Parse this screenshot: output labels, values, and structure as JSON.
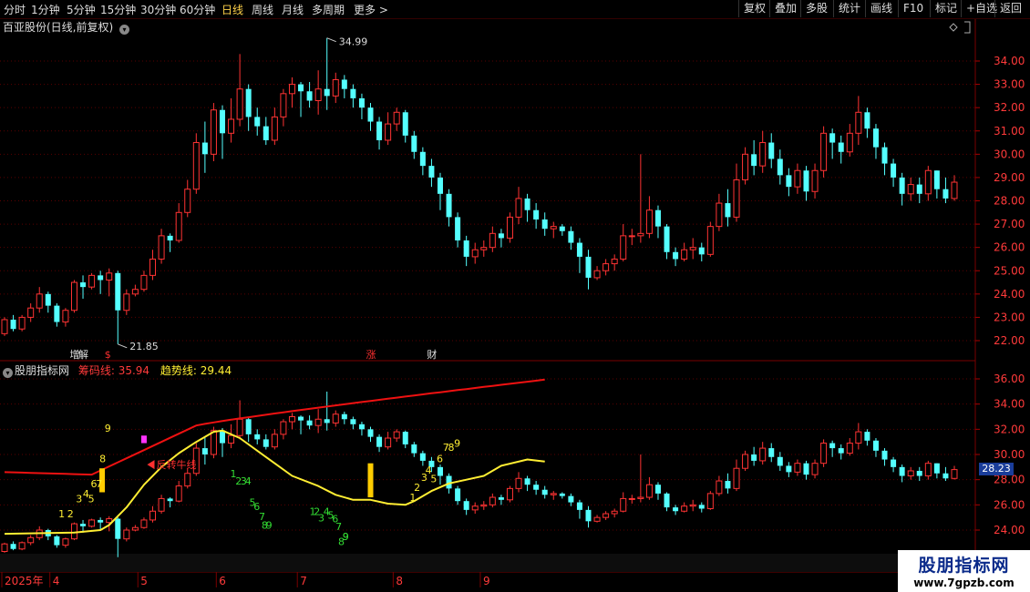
{
  "toolbar": {
    "periods": [
      "分时",
      "1分钟",
      "5分钟",
      "15分钟",
      "30分钟",
      "60分钟",
      "日线",
      "周线",
      "月线",
      "多周期",
      "更多 >"
    ],
    "active": "日线",
    "right": [
      "复权",
      "叠加",
      "多股",
      "统计",
      "画线",
      "F10",
      "标记",
      "+自选",
      "返回"
    ]
  },
  "main": {
    "title": "百亚股份(日线,前复权)",
    "high_label": "34.99",
    "low_label": "21.85",
    "events": [
      {
        "text": "增",
        "color": "#e0e0e0",
        "i": 8
      },
      {
        "text": "解",
        "color": "#e0e0e0",
        "i": 9
      },
      {
        "text": "$",
        "color": "#ff3030",
        "i": 12
      },
      {
        "text": "涨",
        "color": "#ff3030",
        "i": 42
      },
      {
        "text": "财",
        "color": "#e0e0e0",
        "i": 49
      }
    ]
  },
  "indicator": {
    "name": "股朋指标网",
    "line1_label": "筹码线: 35.94",
    "line2_label": "趋势线: 29.44",
    "annotation": "反转牛线",
    "current_price": "28.23"
  },
  "colors": {
    "up": "#ff3333",
    "down": "#54ffff",
    "ma_red": "#ee1111",
    "ma_yellow": "#ffee33",
    "grid": "#5a0000"
  },
  "logo": {
    "line1": "股朋指标网",
    "line2": "www.7gpzb.com"
  },
  "chart_data": {
    "type": "candlestick",
    "y_axis_main": [
      22.0,
      23.0,
      24.0,
      25.0,
      26.0,
      27.0,
      28.0,
      29.0,
      30.0,
      31.0,
      32.0,
      33.0,
      34.0
    ],
    "y_axis_indicator": [
      24.0,
      26.0,
      28.0,
      30.0,
      32.0,
      34.0,
      36.0
    ],
    "x_axis": [
      "2025年",
      "4",
      "5",
      "6",
      "7",
      "8",
      "9"
    ],
    "x_axis_idx": [
      0,
      5.2,
      15.3,
      24.3,
      33.6,
      44.6,
      54.6
    ],
    "candles": [
      [
        22.3,
        22.9,
        22.2,
        23.0
      ],
      [
        22.9,
        22.5,
        22.4,
        23.1
      ],
      [
        22.5,
        23.0,
        22.4,
        23.1
      ],
      [
        23.0,
        23.4,
        22.8,
        23.6
      ],
      [
        23.4,
        24.0,
        23.2,
        24.3
      ],
      [
        24.0,
        23.5,
        23.2,
        24.1
      ],
      [
        23.5,
        22.8,
        22.6,
        23.6
      ],
      [
        22.8,
        23.3,
        22.6,
        23.4
      ],
      [
        23.3,
        24.5,
        23.2,
        24.6
      ],
      [
        24.5,
        24.3,
        23.8,
        24.8
      ],
      [
        24.3,
        24.8,
        24.2,
        24.9
      ],
      [
        24.8,
        24.6,
        24.0,
        25.0
      ],
      [
        24.6,
        24.9,
        23.9,
        25.1
      ],
      [
        24.9,
        23.3,
        21.85,
        25.0
      ],
      [
        23.3,
        24.0,
        23.1,
        24.2
      ],
      [
        24.0,
        24.2,
        23.9,
        24.4
      ],
      [
        24.2,
        24.8,
        24.1,
        25.0
      ],
      [
        24.8,
        25.5,
        24.6,
        25.9
      ],
      [
        25.5,
        26.5,
        25.3,
        26.8
      ],
      [
        26.5,
        26.3,
        25.8,
        26.6
      ],
      [
        26.3,
        27.5,
        26.2,
        27.9
      ],
      [
        27.5,
        28.5,
        27.3,
        28.9
      ],
      [
        28.5,
        30.5,
        28.3,
        30.9
      ],
      [
        30.5,
        30.0,
        29.2,
        31.4
      ],
      [
        30.0,
        31.9,
        29.7,
        32.2
      ],
      [
        31.9,
        30.9,
        29.8,
        32.1
      ],
      [
        30.9,
        31.5,
        30.5,
        32.4
      ],
      [
        31.5,
        32.8,
        31.2,
        34.3
      ],
      [
        32.8,
        31.6,
        31.0,
        33.0
      ],
      [
        31.6,
        31.2,
        30.8,
        32.0
      ],
      [
        31.2,
        30.6,
        30.4,
        31.6
      ],
      [
        30.6,
        31.6,
        30.4,
        32.0
      ],
      [
        31.6,
        32.6,
        31.2,
        32.8
      ],
      [
        32.6,
        33.0,
        32.0,
        33.3
      ],
      [
        33.0,
        32.7,
        31.6,
        33.1
      ]
    ],
    "candles2": [
      [
        32.7,
        32.3,
        32.0,
        33.1
      ],
      [
        32.3,
        32.8,
        31.7,
        33.6
      ],
      [
        32.8,
        32.5,
        31.9,
        34.99
      ],
      [
        32.5,
        33.2,
        32.2,
        33.5
      ],
      [
        33.2,
        32.8,
        32.4,
        33.4
      ],
      [
        32.8,
        32.4,
        32.0,
        33.0
      ],
      [
        32.4,
        32.0,
        31.5,
        32.6
      ],
      [
        32.0,
        31.4,
        31.0,
        32.2
      ],
      [
        31.4,
        30.6,
        30.2,
        31.6
      ],
      [
        30.6,
        31.3,
        30.4,
        31.8
      ],
      [
        31.3,
        31.8,
        31.0,
        32.0
      ],
      [
        31.8,
        30.8,
        30.5,
        31.9
      ],
      [
        30.8,
        30.1,
        29.8,
        31.0
      ],
      [
        30.1,
        29.5,
        29.1,
        30.3
      ],
      [
        29.5,
        29.0,
        28.6,
        29.8
      ],
      [
        29.0,
        28.3,
        27.6,
        29.2
      ],
      [
        28.3,
        27.3,
        26.9,
        28.5
      ],
      [
        27.3,
        26.3,
        26.0,
        27.5
      ],
      [
        26.3,
        25.6,
        25.2,
        26.5
      ],
      [
        25.6,
        25.9,
        25.3,
        26.2
      ],
      [
        25.9,
        26.0,
        25.6,
        26.3
      ],
      [
        26.0,
        26.6,
        25.8,
        26.9
      ],
      [
        26.6,
        26.4,
        26.0,
        26.8
      ],
      [
        26.4,
        27.3,
        26.2,
        27.5
      ],
      [
        27.3,
        28.1,
        27.0,
        28.6
      ],
      [
        28.1,
        27.6,
        27.1,
        28.3
      ],
      [
        27.6,
        27.2,
        26.8,
        27.9
      ],
      [
        27.2,
        26.8,
        26.5,
        27.5
      ],
      [
        26.8,
        26.9,
        26.4,
        27.1
      ],
      [
        26.9,
        26.7,
        26.5,
        27.0
      ],
      [
        26.7,
        26.2,
        25.9,
        26.9
      ],
      [
        26.2,
        25.6,
        24.9,
        26.4
      ],
      [
        25.6,
        24.7,
        24.2,
        25.9
      ],
      [
        24.7,
        25.0,
        24.6,
        25.2
      ],
      [
        25.0,
        25.3,
        24.8,
        25.5
      ],
      [
        25.3,
        25.5,
        25.0,
        25.7
      ],
      [
        25.5,
        26.5,
        25.4,
        27.0
      ],
      [
        26.5,
        26.5,
        26.1,
        26.8
      ],
      [
        26.5,
        26.6,
        26.2,
        30.0
      ],
      [
        26.6,
        27.6,
        26.4,
        28.2
      ],
      [
        27.6,
        26.9,
        26.4,
        27.8
      ],
      [
        26.9,
        25.8,
        25.5,
        27.0
      ],
      [
        25.8,
        25.5,
        25.2,
        26.0
      ],
      [
        25.5,
        25.9,
        25.4,
        26.2
      ],
      [
        25.9,
        26.0,
        25.5,
        26.4
      ],
      [
        26.0,
        25.7,
        25.4,
        26.2
      ],
      [
        25.7,
        26.9,
        25.6,
        27.1
      ],
      [
        26.9,
        27.9,
        26.7,
        28.3
      ],
      [
        27.9,
        27.3,
        26.9,
        28.5
      ],
      [
        27.3,
        28.9,
        27.1,
        29.6
      ],
      [
        28.9,
        30.0,
        28.7,
        30.3
      ],
      [
        30.0,
        29.5,
        29.1,
        30.6
      ],
      [
        29.5,
        30.5,
        29.2,
        31.0
      ],
      [
        30.5,
        29.8,
        29.4,
        30.9
      ],
      [
        29.8,
        29.1,
        28.7,
        30.2
      ],
      [
        29.1,
        28.6,
        28.2,
        29.4
      ],
      [
        28.6,
        29.3,
        28.3,
        29.6
      ],
      [
        29.3,
        28.4,
        28.0,
        29.5
      ],
      [
        28.4,
        29.3,
        28.1,
        29.6
      ],
      [
        29.3,
        30.9,
        29.0,
        31.2
      ],
      [
        30.9,
        30.5,
        29.8,
        31.1
      ],
      [
        30.5,
        30.1,
        29.6,
        30.8
      ],
      [
        30.1,
        30.9,
        29.9,
        31.3
      ],
      [
        30.9,
        31.8,
        30.4,
        32.5
      ],
      [
        31.8,
        31.1,
        30.7,
        32.0
      ],
      [
        31.1,
        30.3,
        29.8,
        31.3
      ],
      [
        30.3,
        29.6,
        29.1,
        30.5
      ],
      [
        29.6,
        29.0,
        28.6,
        29.8
      ],
      [
        29.0,
        28.3,
        27.8,
        29.2
      ],
      [
        28.3,
        28.7,
        28.0,
        29.0
      ],
      [
        28.7,
        28.3,
        27.9,
        29.0
      ],
      [
        28.3,
        29.3,
        28.0,
        29.5
      ],
      [
        29.3,
        28.5,
        28.1,
        29.3
      ],
      [
        28.5,
        28.1,
        27.9,
        29.0
      ],
      [
        28.1,
        28.8,
        28.0,
        29.1
      ]
    ],
    "chip_line": {
      "start": 28.6,
      "end": 35.94
    },
    "trend_line_points": [
      [
        0,
        23.7
      ],
      [
        8,
        23.8
      ],
      [
        11,
        24.0
      ],
      [
        12,
        24.4
      ],
      [
        14,
        25.8
      ],
      [
        16,
        27.6
      ],
      [
        18,
        29.0
      ],
      [
        20,
        30.1
      ],
      [
        22,
        31.0
      ],
      [
        24,
        31.8
      ],
      [
        25,
        31.9
      ],
      [
        27,
        31.3
      ],
      [
        30,
        29.8
      ],
      [
        33,
        28.3
      ],
      [
        36,
        27.5
      ],
      [
        38,
        26.8
      ],
      [
        40,
        26.4
      ],
      [
        42,
        26.4
      ],
      [
        44,
        26.1
      ],
      [
        46,
        26.0
      ],
      [
        47,
        26.3
      ],
      [
        49,
        27.1
      ],
      [
        51,
        27.7
      ],
      [
        53,
        28.0
      ],
      [
        55,
        28.3
      ],
      [
        57,
        29.1
      ],
      [
        60,
        29.6
      ],
      [
        62,
        29.44
      ]
    ],
    "signal_bars": [
      {
        "i": 11.2,
        "lo": 27.0,
        "hi": 28.9
      },
      {
        "i": 42.0,
        "lo": 26.6,
        "hi": 29.3
      }
    ],
    "markers": [
      {
        "i": 16,
        "lo": 30.9,
        "hi": 31.5
      }
    ],
    "counts_yellow": [
      {
        "t": "1",
        "i": 6.5,
        "v": 25.0
      },
      {
        "t": "2",
        "i": 7.5,
        "v": 25.0
      },
      {
        "t": "3",
        "i": 8.5,
        "v": 26.2
      },
      {
        "t": "4",
        "i": 9.3,
        "v": 26.6
      },
      {
        "t": "5",
        "i": 9.9,
        "v": 26.2
      },
      {
        "t": "6",
        "i": 10.2,
        "v": 27.4
      },
      {
        "t": "7",
        "i": 10.8,
        "v": 27.4
      },
      {
        "t": "8",
        "i": 11.2,
        "v": 29.4
      },
      {
        "t": "9",
        "i": 11.8,
        "v": 31.8
      },
      {
        "t": "1",
        "i": 46.8,
        "v": 26.3
      },
      {
        "t": "2",
        "i": 47.3,
        "v": 27.1
      },
      {
        "t": "3",
        "i": 48.1,
        "v": 27.9
      },
      {
        "t": "4",
        "i": 48.6,
        "v": 28.5
      },
      {
        "t": "5",
        "i": 49.2,
        "v": 27.8
      },
      {
        "t": "6",
        "i": 49.9,
        "v": 29.4
      },
      {
        "t": "7",
        "i": 50.6,
        "v": 30.3
      },
      {
        "t": "8",
        "i": 51.2,
        "v": 30.3
      },
      {
        "t": "9",
        "i": 51.9,
        "v": 30.6
      }
    ],
    "counts_green": [
      {
        "t": "1",
        "i": 26.2,
        "v": 28.2
      },
      {
        "t": "2",
        "i": 26.8,
        "v": 27.6
      },
      {
        "t": "3",
        "i": 27.4,
        "v": 27.6
      },
      {
        "t": "4",
        "i": 27.9,
        "v": 27.6
      },
      {
        "t": "5",
        "i": 28.4,
        "v": 25.9
      },
      {
        "t": "6",
        "i": 28.9,
        "v": 25.6
      },
      {
        "t": "7",
        "i": 29.5,
        "v": 24.8
      },
      {
        "t": "8",
        "i": 29.8,
        "v": 24.1
      },
      {
        "t": "9",
        "i": 30.3,
        "v": 24.1
      },
      {
        "t": "1",
        "i": 35.3,
        "v": 25.2
      },
      {
        "t": "2",
        "i": 35.8,
        "v": 25.2
      },
      {
        "t": "3",
        "i": 36.3,
        "v": 24.7
      },
      {
        "t": "4",
        "i": 36.9,
        "v": 25.2
      },
      {
        "t": "5",
        "i": 37.4,
        "v": 24.9
      },
      {
        "t": "6",
        "i": 37.9,
        "v": 24.6
      },
      {
        "t": "7",
        "i": 38.3,
        "v": 24.0
      },
      {
        "t": "8",
        "i": 38.6,
        "v": 22.8
      },
      {
        "t": "9",
        "i": 39.1,
        "v": 23.2
      },
      {
        "t": "9",
        "i": 39.1,
        "v": 23.2
      }
    ]
  }
}
